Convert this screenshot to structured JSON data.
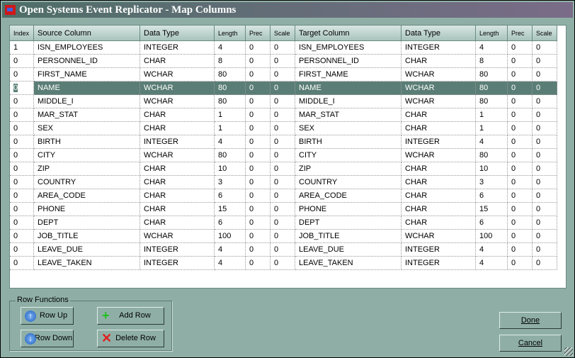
{
  "window": {
    "title": "Open Systems Event Replicator - Map Columns"
  },
  "grid": {
    "headers": [
      "Index",
      "Source Column",
      "Data Type",
      "Length",
      "Prec",
      "Scale",
      "Target Column",
      "Data Type",
      "Length",
      "Prec",
      "Scale"
    ],
    "selected_row": 3,
    "rows": [
      [
        "1",
        "ISN_EMPLOYEES",
        "INTEGER",
        "4",
        "0",
        "0",
        "ISN_EMPLOYEES",
        "INTEGER",
        "4",
        "0",
        "0"
      ],
      [
        "0",
        "PERSONNEL_ID",
        "CHAR",
        "8",
        "0",
        "0",
        "PERSONNEL_ID",
        "CHAR",
        "8",
        "0",
        "0"
      ],
      [
        "0",
        "FIRST_NAME",
        "WCHAR",
        "80",
        "0",
        "0",
        "FIRST_NAME",
        "WCHAR",
        "80",
        "0",
        "0"
      ],
      [
        "0",
        "NAME",
        "WCHAR",
        "80",
        "0",
        "0",
        "NAME",
        "WCHAR",
        "80",
        "0",
        "0"
      ],
      [
        "0",
        "MIDDLE_I",
        "WCHAR",
        "80",
        "0",
        "0",
        "MIDDLE_I",
        "WCHAR",
        "80",
        "0",
        "0"
      ],
      [
        "0",
        "MAR_STAT",
        "CHAR",
        "1",
        "0",
        "0",
        "MAR_STAT",
        "CHAR",
        "1",
        "0",
        "0"
      ],
      [
        "0",
        "SEX",
        "CHAR",
        "1",
        "0",
        "0",
        "SEX",
        "CHAR",
        "1",
        "0",
        "0"
      ],
      [
        "0",
        "BIRTH",
        "INTEGER",
        "4",
        "0",
        "0",
        "BIRTH",
        "INTEGER",
        "4",
        "0",
        "0"
      ],
      [
        "0",
        "CITY",
        "WCHAR",
        "80",
        "0",
        "0",
        "CITY",
        "WCHAR",
        "80",
        "0",
        "0"
      ],
      [
        "0",
        "ZIP",
        "CHAR",
        "10",
        "0",
        "0",
        "ZIP",
        "CHAR",
        "10",
        "0",
        "0"
      ],
      [
        "0",
        "COUNTRY",
        "CHAR",
        "3",
        "0",
        "0",
        "COUNTRY",
        "CHAR",
        "3",
        "0",
        "0"
      ],
      [
        "0",
        "AREA_CODE",
        "CHAR",
        "6",
        "0",
        "0",
        "AREA_CODE",
        "CHAR",
        "6",
        "0",
        "0"
      ],
      [
        "0",
        "PHONE",
        "CHAR",
        "15",
        "0",
        "0",
        "PHONE",
        "CHAR",
        "15",
        "0",
        "0"
      ],
      [
        "0",
        "DEPT",
        "CHAR",
        "6",
        "0",
        "0",
        "DEPT",
        "CHAR",
        "6",
        "0",
        "0"
      ],
      [
        "0",
        "JOB_TITLE",
        "WCHAR",
        "100",
        "0",
        "0",
        "JOB_TITLE",
        "WCHAR",
        "100",
        "0",
        "0"
      ],
      [
        "0",
        "LEAVE_DUE",
        "INTEGER",
        "4",
        "0",
        "0",
        "LEAVE_DUE",
        "INTEGER",
        "4",
        "0",
        "0"
      ],
      [
        "0",
        "LEAVE_TAKEN",
        "INTEGER",
        "4",
        "0",
        "0",
        "LEAVE_TAKEN",
        "INTEGER",
        "4",
        "0",
        "0"
      ]
    ]
  },
  "row_functions": {
    "label": "Row Functions",
    "row_up": "Row Up",
    "add_row": "Add Row",
    "row_down": "Row Down",
    "delete_row": "Delete Row"
  },
  "buttons": {
    "done": "Done",
    "cancel": "Cancel"
  }
}
